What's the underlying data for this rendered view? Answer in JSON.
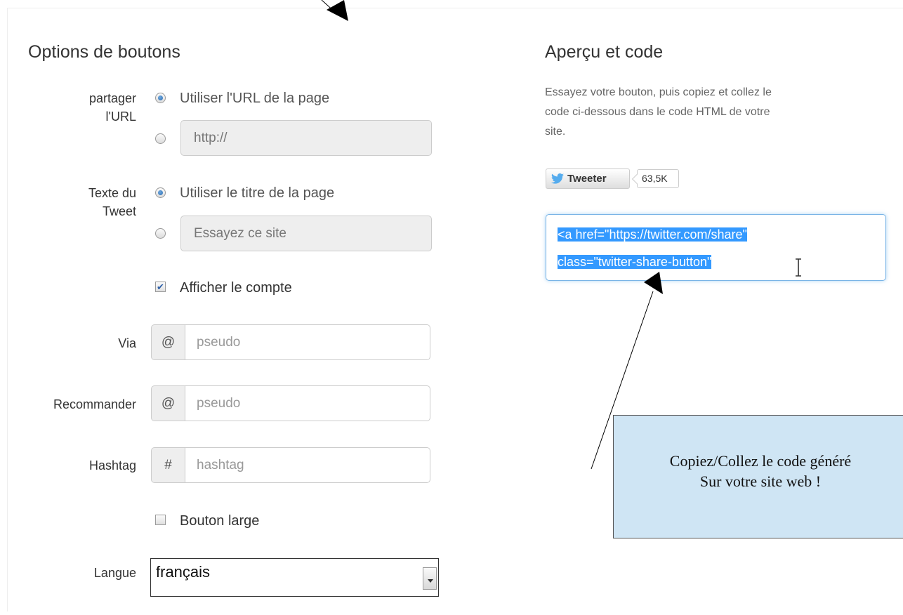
{
  "options": {
    "title": "Options de boutons",
    "share_url": {
      "label_line1": "partager",
      "label_line2": "l'URL",
      "option_default": "Utiliser l'URL de la page",
      "custom_placeholder": "http://",
      "selected": "default"
    },
    "tweet_text": {
      "label_line1": "Texte du",
      "label_line2": "Tweet",
      "option_default": "Utiliser le titre de la page",
      "custom_placeholder": "Essayez ce site",
      "selected": "default"
    },
    "show_count": {
      "label": "Afficher le compte",
      "checked": true
    },
    "via": {
      "label": "Via",
      "prefix": "@",
      "placeholder": "pseudo"
    },
    "recommend": {
      "label": "Recommander",
      "prefix": "@",
      "placeholder": "pseudo"
    },
    "hashtag": {
      "label": "Hashtag",
      "prefix": "#",
      "placeholder": "hashtag"
    },
    "large_button": {
      "label": "Bouton large",
      "checked": false
    },
    "language": {
      "label": "Langue",
      "value": "français"
    }
  },
  "preview": {
    "title": "Aperçu et code",
    "description_line1": "Essayez votre bouton, puis copiez et collez le",
    "description_line2": "code ci-dessous dans le code HTML de votre",
    "description_line3": "site.",
    "tweet_button_label": "Tweeter",
    "tweet_count": "63,5K",
    "code_line1": "<a href=\"https://twitter.com/share\"",
    "code_line2": "class=\"twitter-share-button\""
  },
  "callout": {
    "line1": "Copiez/Collez le code généré",
    "line2": "Sur votre site web !"
  },
  "colors": {
    "selection": "#3399ff",
    "callout_bg": "#cfe5f4",
    "twitter_blue": "#55acee",
    "focus_border": "#79b4e6"
  }
}
